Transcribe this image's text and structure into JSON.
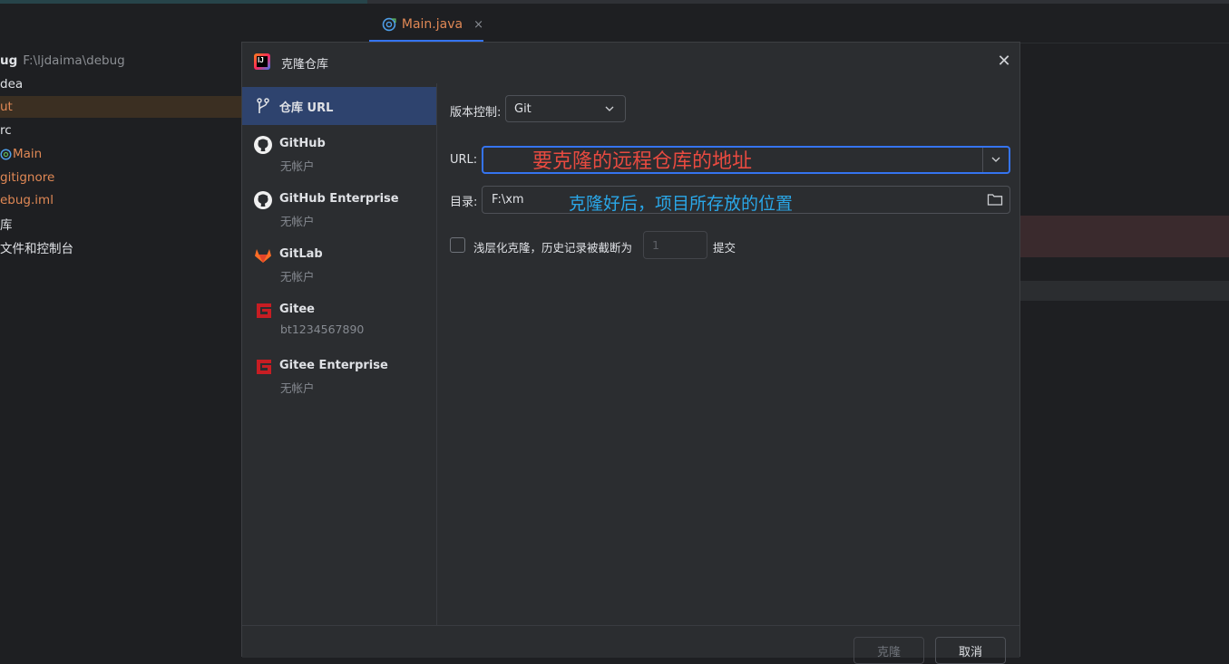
{
  "editor": {
    "tab_label": "Main.java",
    "tab_close": "×"
  },
  "project_tree": {
    "items": [
      {
        "label": "ug",
        "hint": "F:\\ljdaima\\debug",
        "color": "#dfe1e5",
        "bold": true
      },
      {
        "label": "dea",
        "color": "#dfe1e5"
      },
      {
        "label": "ut",
        "color": "#e08855",
        "selected": true
      },
      {
        "label": "rc",
        "color": "#dfe1e5"
      },
      {
        "label": "Main",
        "color": "#e08855",
        "icon": "java-class-icon"
      },
      {
        "label": "gitignore",
        "color": "#e08855"
      },
      {
        "label": "ebug.iml",
        "color": "#e08855"
      },
      {
        "label": "库",
        "color": "#dfe1e5"
      },
      {
        "label": "文件和控制台",
        "color": "#dfe1e5"
      }
    ]
  },
  "dialog": {
    "title": "克隆仓库",
    "close_icon": "close-icon",
    "sidebar": [
      {
        "name": "仓库 URL",
        "sub": "",
        "icon": "vcs-branch-icon",
        "active": true
      },
      {
        "name": "GitHub",
        "sub": "无帐户",
        "icon": "github-icon"
      },
      {
        "name": "GitHub Enterprise",
        "sub": "无帐户",
        "icon": "github-icon"
      },
      {
        "name": "GitLab",
        "sub": "无帐户",
        "icon": "gitlab-icon"
      },
      {
        "name": "Gitee",
        "sub": "bt1234567890",
        "icon": "gitee-icon"
      },
      {
        "name": "Gitee Enterprise",
        "sub": "无帐户",
        "icon": "gitee-icon"
      }
    ],
    "form": {
      "vcs_label": "版本控制:",
      "vcs_value": "Git",
      "url_label": "URL:",
      "url_value": "",
      "url_annotation": "要克隆的远程仓库的地址",
      "dir_label": "目录:",
      "dir_value": "F:\\xm",
      "dir_annotation": "克隆好后，项目所存放的位置",
      "shallow_label": "浅层化克隆，历史记录被截断为",
      "shallow_checked": false,
      "depth_value": "1",
      "commit_label": "提交"
    },
    "buttons": {
      "clone": "克隆",
      "cancel": "取消"
    }
  },
  "colors": {
    "accent": "#3574f0",
    "annotation_red": "#e84a40",
    "annotation_blue": "#2aa7e8",
    "gitee_red": "#c71d23",
    "gitlab_orange": "#fc6d26"
  }
}
